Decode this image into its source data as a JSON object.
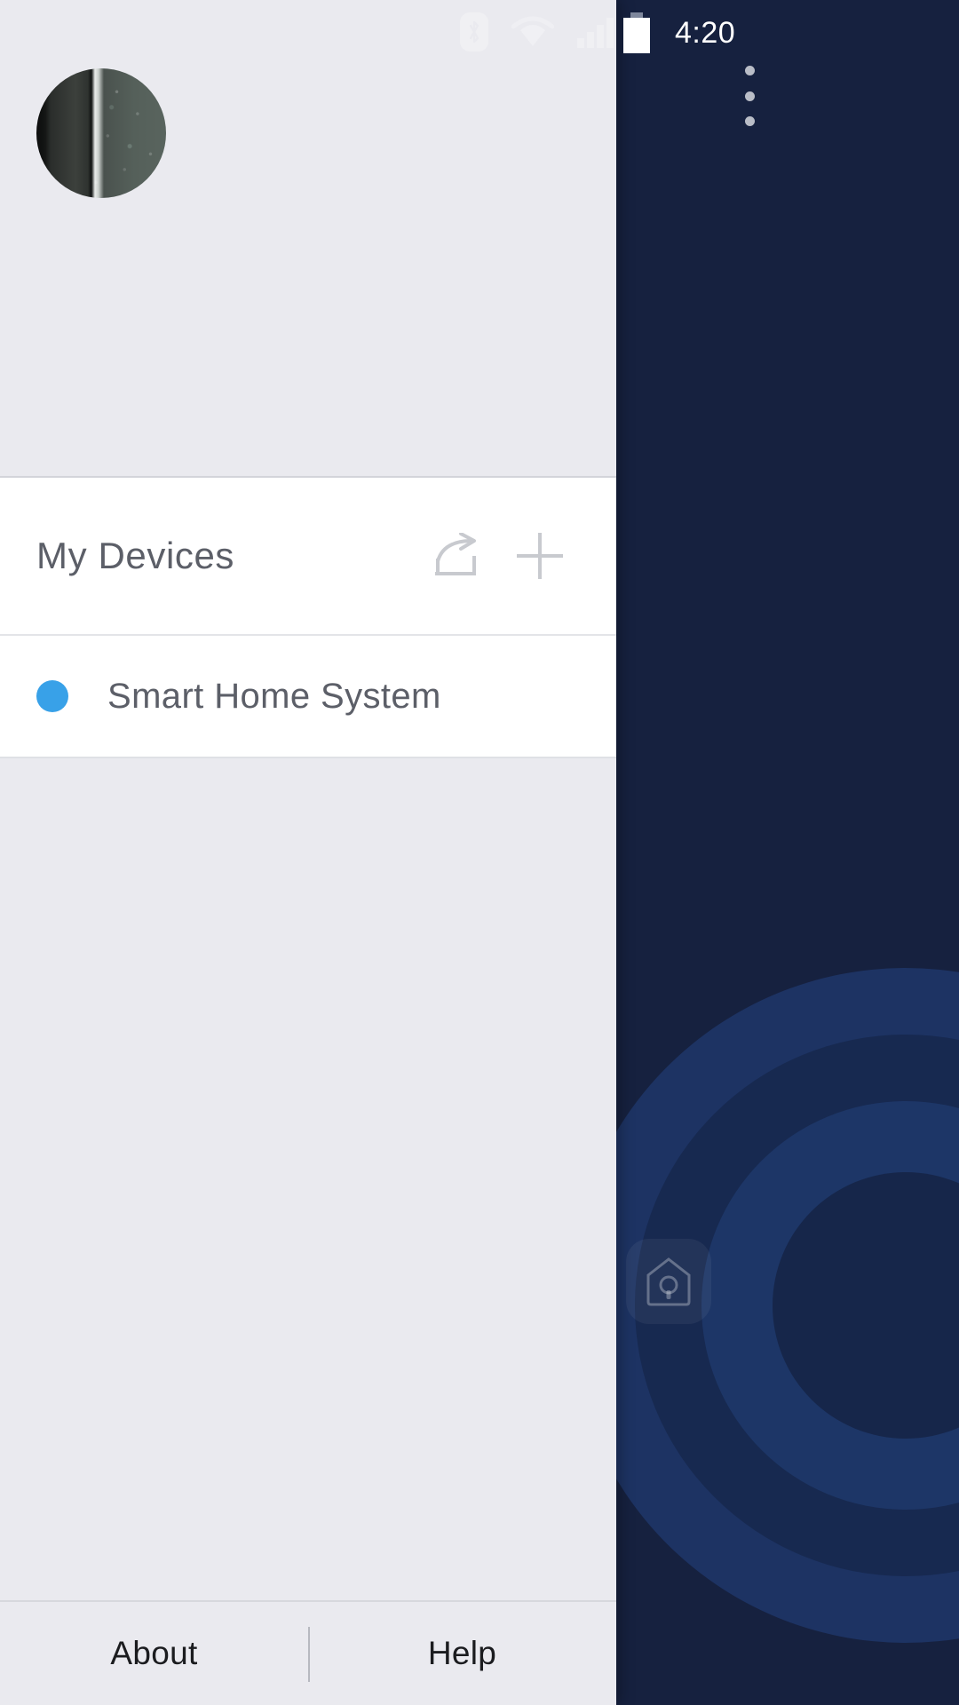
{
  "status_bar": {
    "icons": [
      "bluetooth-icon",
      "wifi-icon",
      "cellular-signal-icon",
      "battery-icon"
    ],
    "clock": "4:20",
    "signal_bars": 4,
    "wifi_strength": "full",
    "battery_state": "full"
  },
  "app_background": {
    "overflow_menu": "overflow-menu-icon",
    "app_icon": "smart-home-app-icon",
    "accent_color": "#1d3363",
    "background_color": "#16213f"
  },
  "drawer": {
    "avatar": "user-avatar-photo",
    "devices_section": {
      "title": "My Devices",
      "share_label": "share-icon",
      "add_label": "add-device-icon"
    },
    "devices": [
      {
        "name": "Smart Home System",
        "status_color": "#38a1e8",
        "status": "online"
      }
    ],
    "footer": {
      "about_label": "About",
      "help_label": "Help"
    }
  }
}
